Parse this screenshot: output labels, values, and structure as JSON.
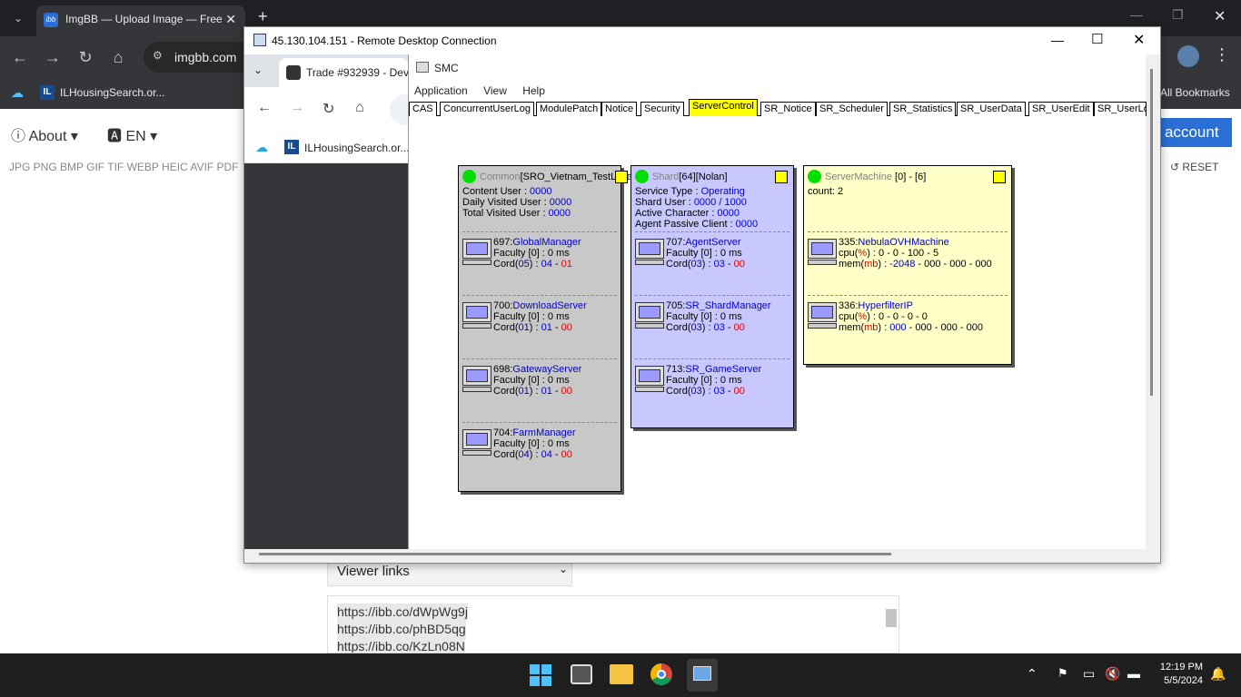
{
  "chrome": {
    "tab_title": "ImgBB — Upload Image — Free",
    "url": "imgbb.com",
    "bookmark1": "ILHousingSearch.or...",
    "all_bookmarks": "All Bookmarks"
  },
  "imgbb": {
    "about": "About",
    "lang": "EN",
    "formats": "JPG PNG BMP GIF TIF WEBP HEIC AVIF PDF",
    "account": "account",
    "reset": "RESET",
    "viewer_select": "Viewer links",
    "links": [
      "https://ibb.co/dWpWg9j",
      "https://ibb.co/phBD5qg",
      "https://ibb.co/KzLn08N"
    ]
  },
  "rdp": {
    "title": "45.130.104.151 - Remote Desktop Connection",
    "inner_tab": "Trade #932939 - Dev",
    "inner_bookmark": "ILHousingSearch.or..."
  },
  "smc": {
    "title": "SMC",
    "menu": [
      "Application",
      "View",
      "Help"
    ],
    "tabs": [
      "CAS",
      "ConcurrentUserLog",
      "ModulePatch",
      "Notice",
      "Security",
      "ServerControl",
      "SR_Notice",
      "SR_Scheduler",
      "SR_Statistics",
      "SR_UserData",
      "SR_UserEdit",
      "SR_UserLo"
    ],
    "common": {
      "title_gray": "Common",
      "title_rest": "[SRO_Vietnam_TestLocal]",
      "stats": [
        [
          "Content User : ",
          "0000"
        ],
        [
          "Daily Visited User : ",
          "0000"
        ],
        [
          "Total Visited User : ",
          "0000"
        ]
      ],
      "servers": [
        {
          "id": "697:",
          "name": "GlobalManager",
          "faculty": "Faculty [0] : 0 ms",
          "cord_a": "05",
          "cord_b": "04",
          "cord_c": "01"
        },
        {
          "id": "700:",
          "name": "DownloadServer",
          "faculty": "Faculty [0] : 0 ms",
          "cord_a": "01",
          "cord_b": "01",
          "cord_c": "00"
        },
        {
          "id": "698:",
          "name": "GatewayServer",
          "faculty": "Faculty [0] : 0 ms",
          "cord_a": "01",
          "cord_b": "01",
          "cord_c": "00"
        },
        {
          "id": "704:",
          "name": "FarmManager",
          "faculty": "Faculty [0] : 0 ms",
          "cord_a": "04",
          "cord_b": "04",
          "cord_c": "00"
        }
      ]
    },
    "shard": {
      "title_gray": "Shard",
      "title_rest": "[64][Nolan]",
      "stats": [
        [
          "Service Type : ",
          "Operating"
        ],
        [
          "Shard User : ",
          "0000 / 1000"
        ],
        [
          "Active Character : ",
          "0000"
        ],
        [
          "Agent Passive Client : ",
          "0000"
        ]
      ],
      "servers": [
        {
          "id": "707:",
          "name": "AgentServer",
          "faculty": "Faculty [0] : 0 ms",
          "cord_a": "03",
          "cord_b": "03",
          "cord_c": "00"
        },
        {
          "id": "705:",
          "name": "SR_ShardManager",
          "faculty": "Faculty [0] : 0 ms",
          "cord_a": "03",
          "cord_b": "03",
          "cord_c": "00"
        },
        {
          "id": "713:",
          "name": "SR_GameServer",
          "faculty": "Faculty [0] : 0 ms",
          "cord_a": "03",
          "cord_b": "03",
          "cord_c": "00"
        }
      ]
    },
    "machine": {
      "title_gray": "ServerMachine",
      "title_rest": " [0] - [6]",
      "count": "count: 2",
      "items": [
        {
          "id": "335:",
          "name": "NebulaOVHMachine",
          "cpu": " : 0 - 0 - 100 - 5",
          "mem_val": "-2048",
          "mem_rest": " - 000 - 000 - 000"
        },
        {
          "id": "336:",
          "name": "HyperfilterIP",
          "cpu": " : 0 - 0 - 0 - 0",
          "mem_val": "000",
          "mem_rest": " - 000 - 000 - 000"
        }
      ]
    }
  },
  "taskbar": {
    "time": "12:19 PM",
    "date": "5/5/2024"
  }
}
